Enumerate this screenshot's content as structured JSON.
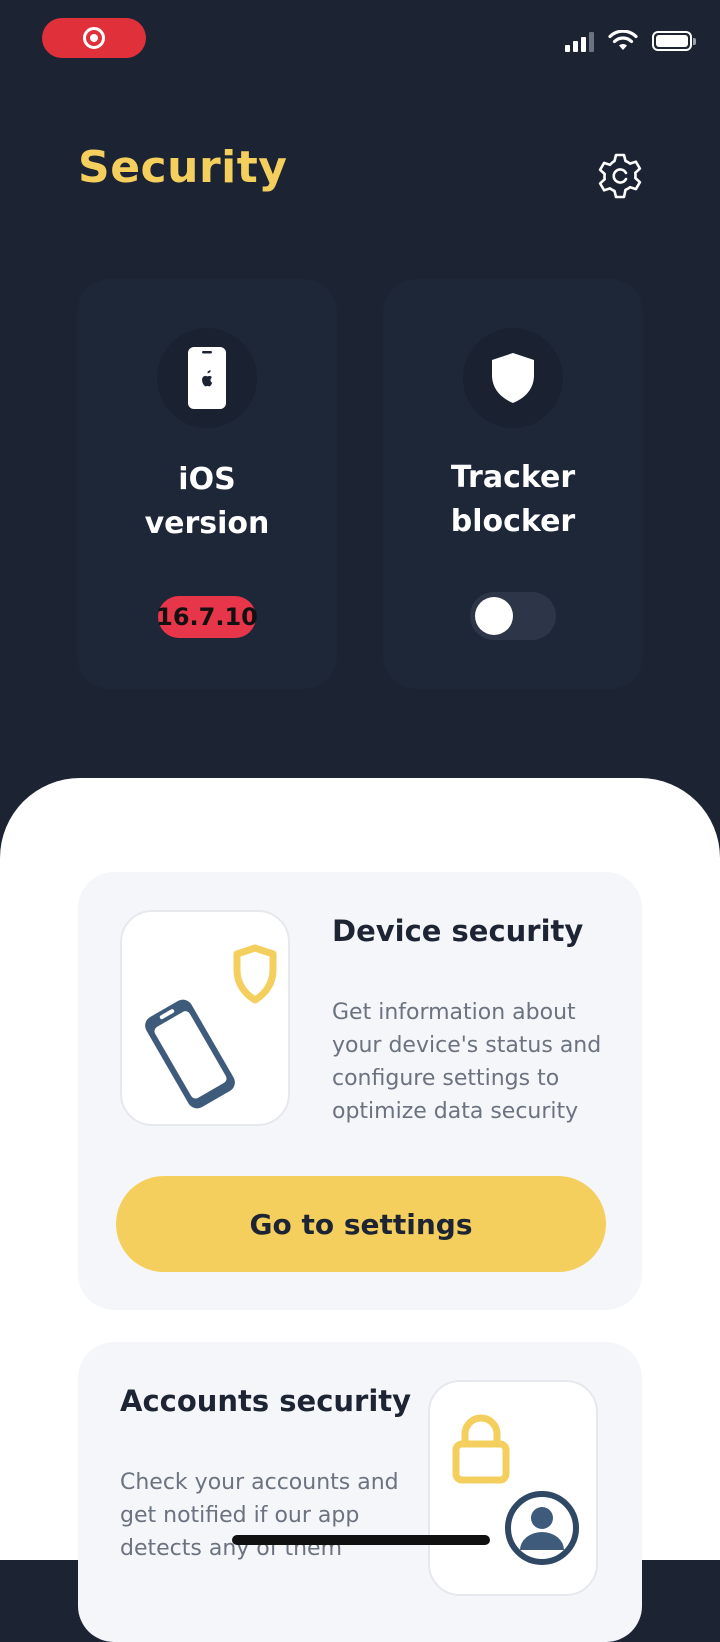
{
  "status_bar": {
    "recording_icon": "record-icon",
    "signal_icon": "cellular-signal-icon",
    "wifi_icon": "wifi-icon",
    "battery_icon": "battery-icon",
    "colors": {
      "recording": "#e0313b"
    }
  },
  "header": {
    "title": "Security",
    "settings_icon": "gear-icon",
    "title_color": "#f5cf5e"
  },
  "tiles": [
    {
      "icon": "iphone-icon",
      "label": "iOS\nversion",
      "badge": "16.7.10",
      "badge_color": "#e7364a"
    },
    {
      "icon": "shield-icon",
      "label": "Tracker\nblocker",
      "toggle_on": false
    }
  ],
  "cards": {
    "device_security": {
      "title": "Device security",
      "description": "Get information about your device's status and configure settings to optimize data security",
      "button_label": "Go to settings",
      "illustration": "phone-shield-icon",
      "button_color": "#f5cf5e"
    },
    "accounts_security": {
      "title": "Accounts security",
      "description": "Check your accounts and get notified if our app detects any of them",
      "illustration": "lock-user-icon"
    }
  },
  "background_color": "#1c2433"
}
